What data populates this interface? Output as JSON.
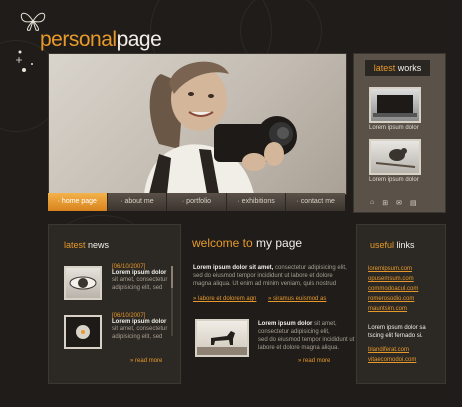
{
  "brand": {
    "part1": "personal",
    "part2": "page"
  },
  "nav": {
    "items": [
      "home page",
      "about me",
      "portfolio",
      "exhibitions",
      "contact me"
    ]
  },
  "latest_works": {
    "title_a": "latest",
    "title_b": "works",
    "items": [
      {
        "caption": "Lorem ipsum dolor"
      },
      {
        "caption": "Lorem ipsum dolor"
      }
    ]
  },
  "latest_news": {
    "title_a": "latest",
    "title_b": "news",
    "items": [
      {
        "date": "[06/10/2007]",
        "title": "Lorem ipsum dolor",
        "body1": "sit amet, consectetur",
        "body2": "adipisicing elit, sed"
      },
      {
        "date": "[06/10/2007]",
        "title": "Lorem ipsum dolor",
        "body1": "sit amet, consectetur",
        "body2": "adipisicing elit, sed"
      }
    ],
    "read_more": "read more"
  },
  "welcome": {
    "title_a": "welcome to",
    "title_b": "my page",
    "lead_bold": "Lorem ipsum dolor sit amet,",
    "lead_rest1": "consectetur adipisicing elit,",
    "lead_line2": "sed do eiusmod tempor incididunt ut labore et dolore",
    "lead_line3": "magna aliqua. Ut enim ad minim veniam, quis nostrud",
    "link1": "labore et dolorem agn",
    "link2": "siramus euismod as",
    "p2_bold": "Lorem ipsum dolor",
    "p2_rest": "sit amet, consectetur adipisicing elit,",
    "p2_line2": "sed do eiusmod tempor incididunt ut",
    "p2_line3": "labore et dolore magna aliqua.",
    "read_more": "read more"
  },
  "useful_links": {
    "title_a": "useful",
    "title_b": "links",
    "links1": [
      "loremipsum.com",
      "opusemsum.com",
      "commodoacul.com",
      "romerosodio.com",
      "mauntsim.com"
    ],
    "text1": "Lorem ipsum dolor sa",
    "text2": "tscing elit fernado si.",
    "links2": [
      "blandiferat.com",
      "vitaecomodoi.com"
    ]
  },
  "colors": {
    "accent": "#e79a2b",
    "bg": "#1f1c19",
    "panel": "#2c2824"
  }
}
